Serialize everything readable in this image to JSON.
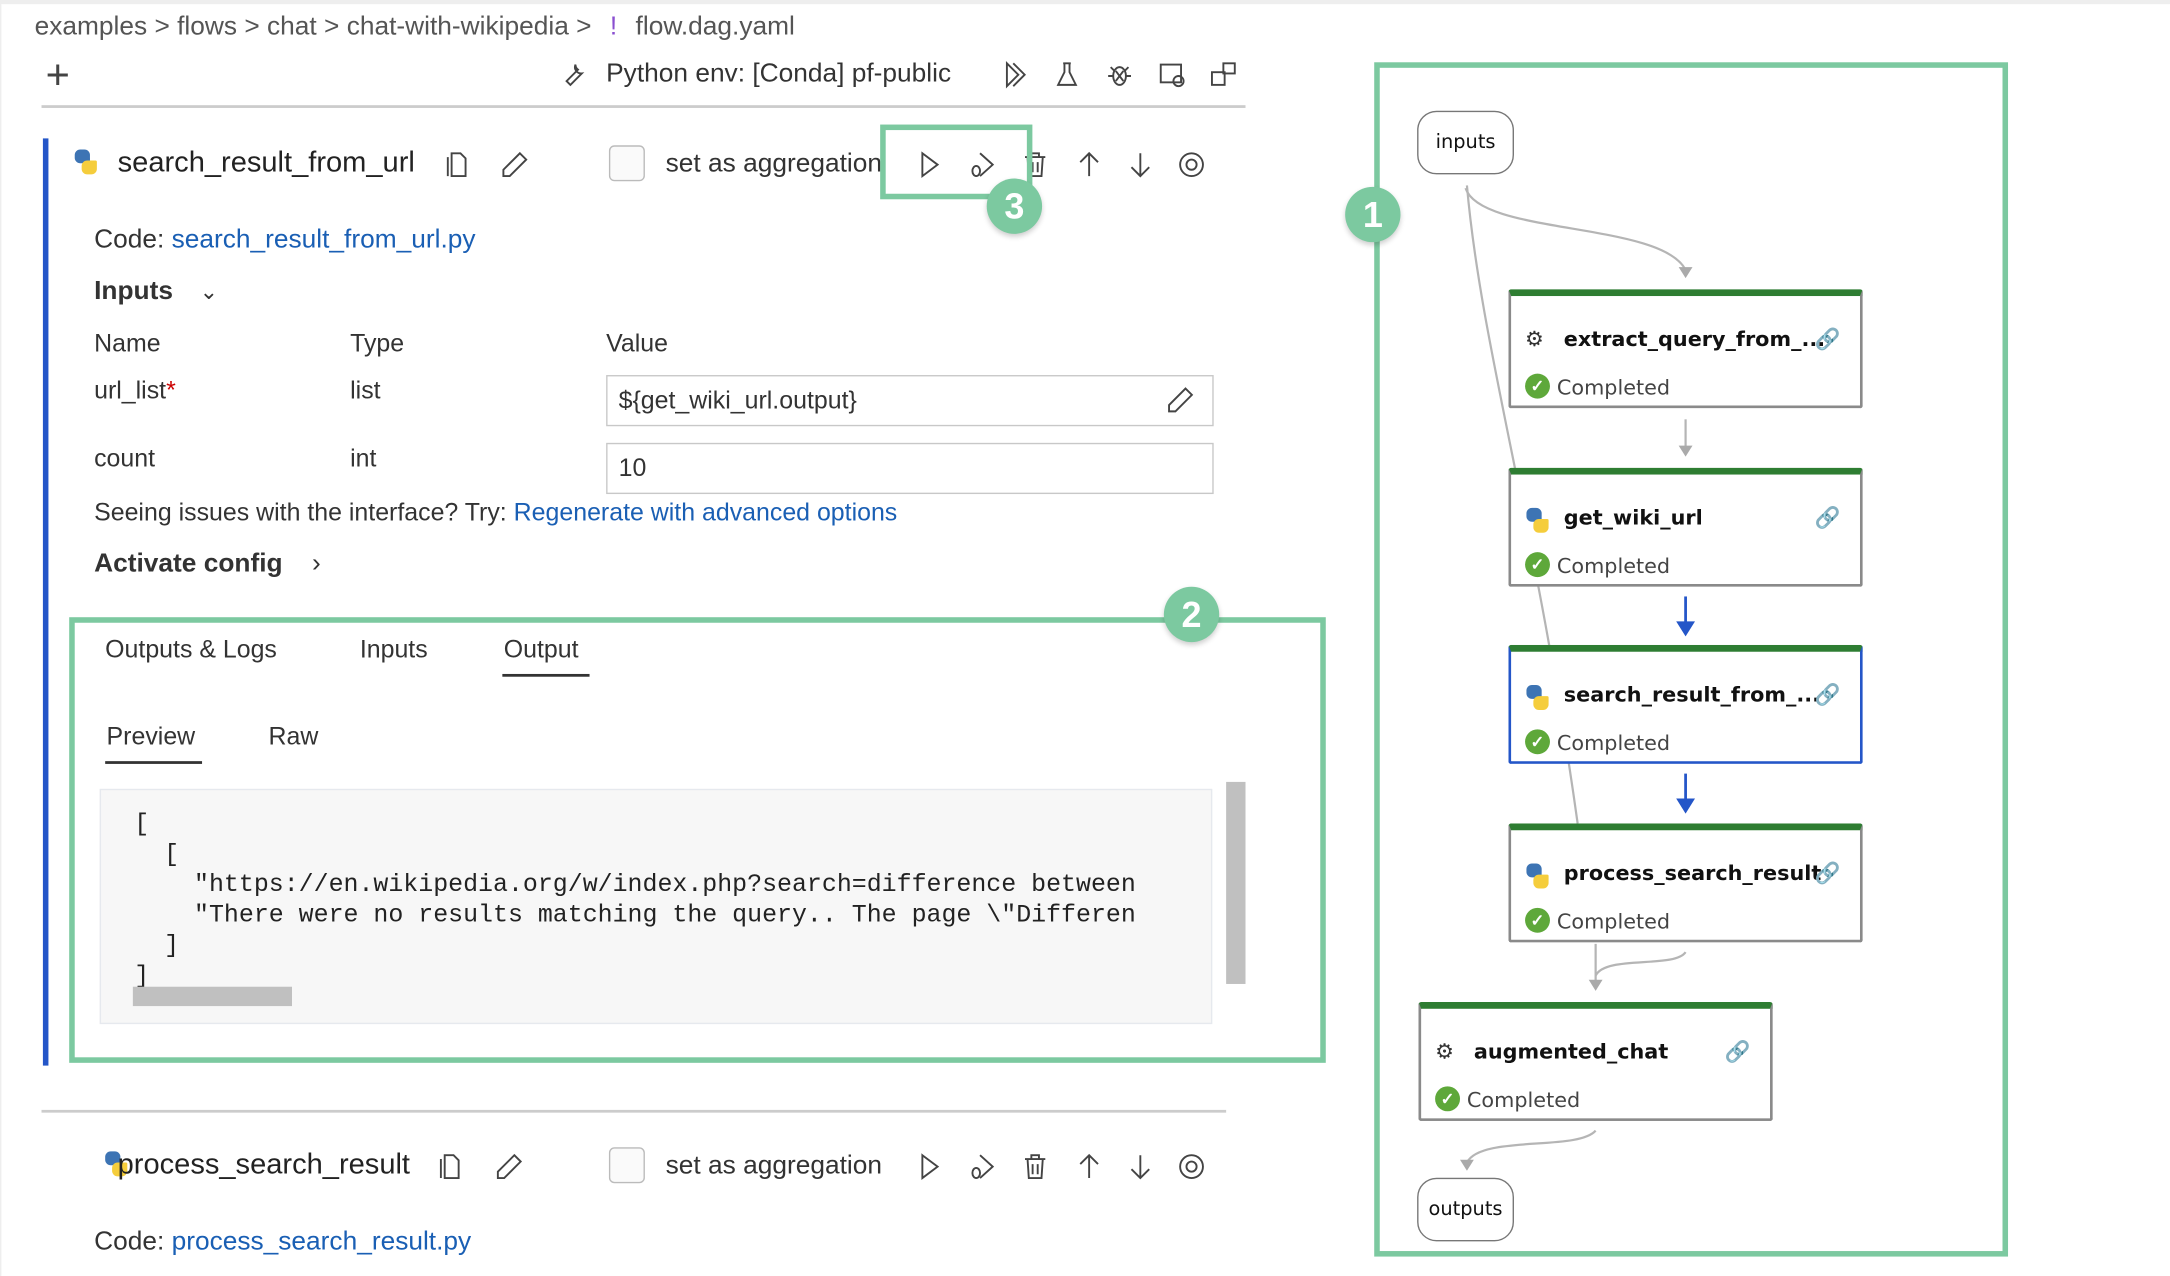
{
  "breadcrumb": {
    "items": [
      "examples",
      "flows",
      "chat",
      "chat-with-wikipedia"
    ],
    "file_icon": "!",
    "file": "flow.dag.yaml"
  },
  "toolbar": {
    "add": "+",
    "env_label": "Python env: [Conda] pf-public",
    "icons": [
      "wrench-icon",
      "run-all-icon",
      "flask-icon",
      "debug-icon",
      "layout-icon",
      "graph-icon"
    ]
  },
  "node1": {
    "name": "search_result_from_url",
    "aggregation_label": "set as aggregation",
    "code_label": "Code:",
    "code_file": "search_result_from_url.py",
    "inputs_title": "Inputs",
    "columns": [
      "Name",
      "Type",
      "Value"
    ],
    "inputs": [
      {
        "name": "url_list",
        "required": "*",
        "type": "list",
        "value": "${get_wiki_url.output}"
      },
      {
        "name": "count",
        "required": "",
        "type": "int",
        "value": "10"
      }
    ],
    "issues_text": "Seeing issues with the interface? Try:",
    "issues_link": "Regenerate with advanced options",
    "activate_config": "Activate config"
  },
  "output_panel": {
    "tabs": [
      "Outputs & Logs",
      "Inputs",
      "Output"
    ],
    "active_tab": "Output",
    "subtabs": [
      "Preview",
      "Raw"
    ],
    "active_subtab": "Preview",
    "code_lines": [
      "[",
      "  [",
      "    \"https://en.wikipedia.org/w/index.php?search=difference between",
      "    \"There were no results matching the query.. The page \\\"Differen",
      "  ]",
      "]"
    ]
  },
  "node2": {
    "name": "process_search_result",
    "aggregation_label": "set as aggregation",
    "code_label": "Code:",
    "code_file": "process_search_result.py"
  },
  "graph": {
    "inputs_label": "inputs",
    "outputs_label": "outputs",
    "nodes": [
      {
        "name": "extract_query_from_...",
        "type": "llm",
        "status": "Completed"
      },
      {
        "name": "get_wiki_url",
        "type": "python",
        "status": "Completed"
      },
      {
        "name": "search_result_from_...",
        "type": "python",
        "status": "Completed",
        "selected": true
      },
      {
        "name": "process_search_result",
        "type": "python",
        "status": "Completed"
      },
      {
        "name": "augmented_chat",
        "type": "llm",
        "status": "Completed"
      }
    ]
  },
  "annotations": [
    "1",
    "2",
    "3"
  ],
  "colors": {
    "annotation": "#7cc9a0",
    "link": "#1a5fb4",
    "node_top": "#2e7d32",
    "selected": "#2456c8",
    "status_ok": "#5ea83a"
  }
}
